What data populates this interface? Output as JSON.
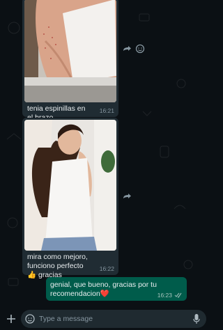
{
  "messages": [
    {
      "caption": "tenia espinillas en el brazo",
      "time": "16:21"
    },
    {
      "caption": "mira como mejoro, funciono perfecto 👍 gracias",
      "time": "16:22"
    }
  ],
  "reply": {
    "text": "genial, que bueno, gracias por tu recomendacion❤️",
    "time": "16:23"
  },
  "composer": {
    "placeholder": "Type a message"
  },
  "colors": {
    "incoming": "#202c33",
    "outgoing": "#005c4b",
    "background": "#0b1014"
  }
}
